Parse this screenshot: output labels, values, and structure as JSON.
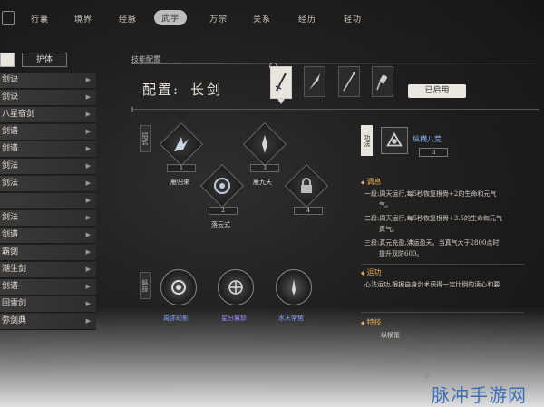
{
  "tabs": [
    {
      "label": "行囊"
    },
    {
      "label": "境界"
    },
    {
      "label": "经脉"
    },
    {
      "label": "武学"
    },
    {
      "label": "万宗"
    },
    {
      "label": "关系"
    },
    {
      "label": "经历"
    },
    {
      "label": "轻功"
    }
  ],
  "active_tab_index": 3,
  "left_panel": {
    "top_button_label": "护体",
    "items": [
      {
        "label": "剑诀"
      },
      {
        "label": "剑诀"
      },
      {
        "label": "八星宿剑"
      },
      {
        "label": "剑谱"
      },
      {
        "label": "剑谱"
      },
      {
        "label": "剑法"
      },
      {
        "label": "剑法"
      },
      {
        "label": ""
      },
      {
        "label": "剑法"
      },
      {
        "label": "剑谱"
      },
      {
        "label": "霸剑"
      },
      {
        "label": "潮生剑"
      },
      {
        "label": "剑谱"
      },
      {
        "label": "回雪剑"
      },
      {
        "label": "弥剑典"
      }
    ]
  },
  "config": {
    "section_title": "技能配置",
    "label": "配置:",
    "weapon": "长剑",
    "active_slot_label": "剑",
    "enabled_button": "已启用"
  },
  "sword_skills": {
    "category_label": "招式",
    "nodes": [
      {
        "num": "1",
        "name": "雁归来",
        "icon": "slash-burst-icon"
      },
      {
        "num": "3",
        "name": "雁九天",
        "icon": "blade-icon"
      },
      {
        "num": "2",
        "name": "落云式",
        "icon": "vortex-icon"
      },
      {
        "num": "4",
        "name": "",
        "icon": "lock-icon"
      }
    ]
  },
  "inner_skills": {
    "category_label": "纵技",
    "nodes": [
      {
        "name": "周弥幻影",
        "color": "#8aa6ff",
        "icon": "eye-orb-icon"
      },
      {
        "name": "星分翼轸",
        "color": "#9d8cff",
        "icon": "star-orb-icon"
      },
      {
        "name": "水天常势",
        "color": "#8aa6ff",
        "icon": "sword-orb-icon"
      }
    ]
  },
  "info": {
    "category_label": "功法",
    "title": "纵横八荒",
    "rank": "II",
    "sec_tiao": "调息",
    "tiao_lines": [
      "一段:周天运行,每5秒恢复根骨+2的生命和元气",
      "气。",
      "二段:周天运行,每5秒恢复根骨+3.5的生命和元气",
      "真气。",
      "三段:真元充盈,沸运盈天。当真气大于2800点时",
      "提升双防600。"
    ],
    "sec_yun": "运功",
    "yun_text": "心法运功,根据自身剑术获得一定比例的读心和要",
    "sec_te": "特技",
    "te_text": "纵横策"
  },
  "watermark": "脉冲手游网",
  "colors": {
    "accent_gold": "#e6a94a",
    "accent_blue": "#8fb6ff"
  }
}
